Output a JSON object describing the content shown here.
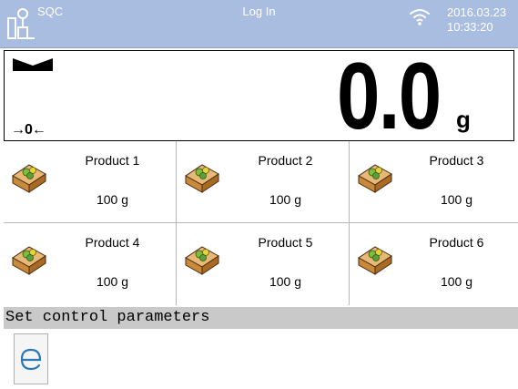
{
  "header": {
    "mode": "SQC",
    "status": "Log In",
    "date": "2016.03.23",
    "time": "10:33:20"
  },
  "display": {
    "weight": "0.0",
    "unit": "g",
    "zero_indicator": "→0←",
    "stable": true
  },
  "products": [
    {
      "name": "Product 1",
      "mass": "100 g"
    },
    {
      "name": "Product 2",
      "mass": "100 g"
    },
    {
      "name": "Product 3",
      "mass": "100 g"
    },
    {
      "name": "Product 4",
      "mass": "100 g"
    },
    {
      "name": "Product 5",
      "mass": "100 g"
    },
    {
      "name": "Product 6",
      "mass": "100 g"
    }
  ],
  "status_bar": {
    "message": "Set control parameters"
  },
  "icons": {
    "logo": "scale-logo-icon",
    "wifi": "wifi-icon",
    "stable": "stability-marker-icon",
    "product": "product-box-icon",
    "exit": "e-exit-icon"
  },
  "colors": {
    "header_bg": "#a9bde0",
    "status_bar_bg": "#c9c9c9",
    "header_text": "#ffffff"
  }
}
